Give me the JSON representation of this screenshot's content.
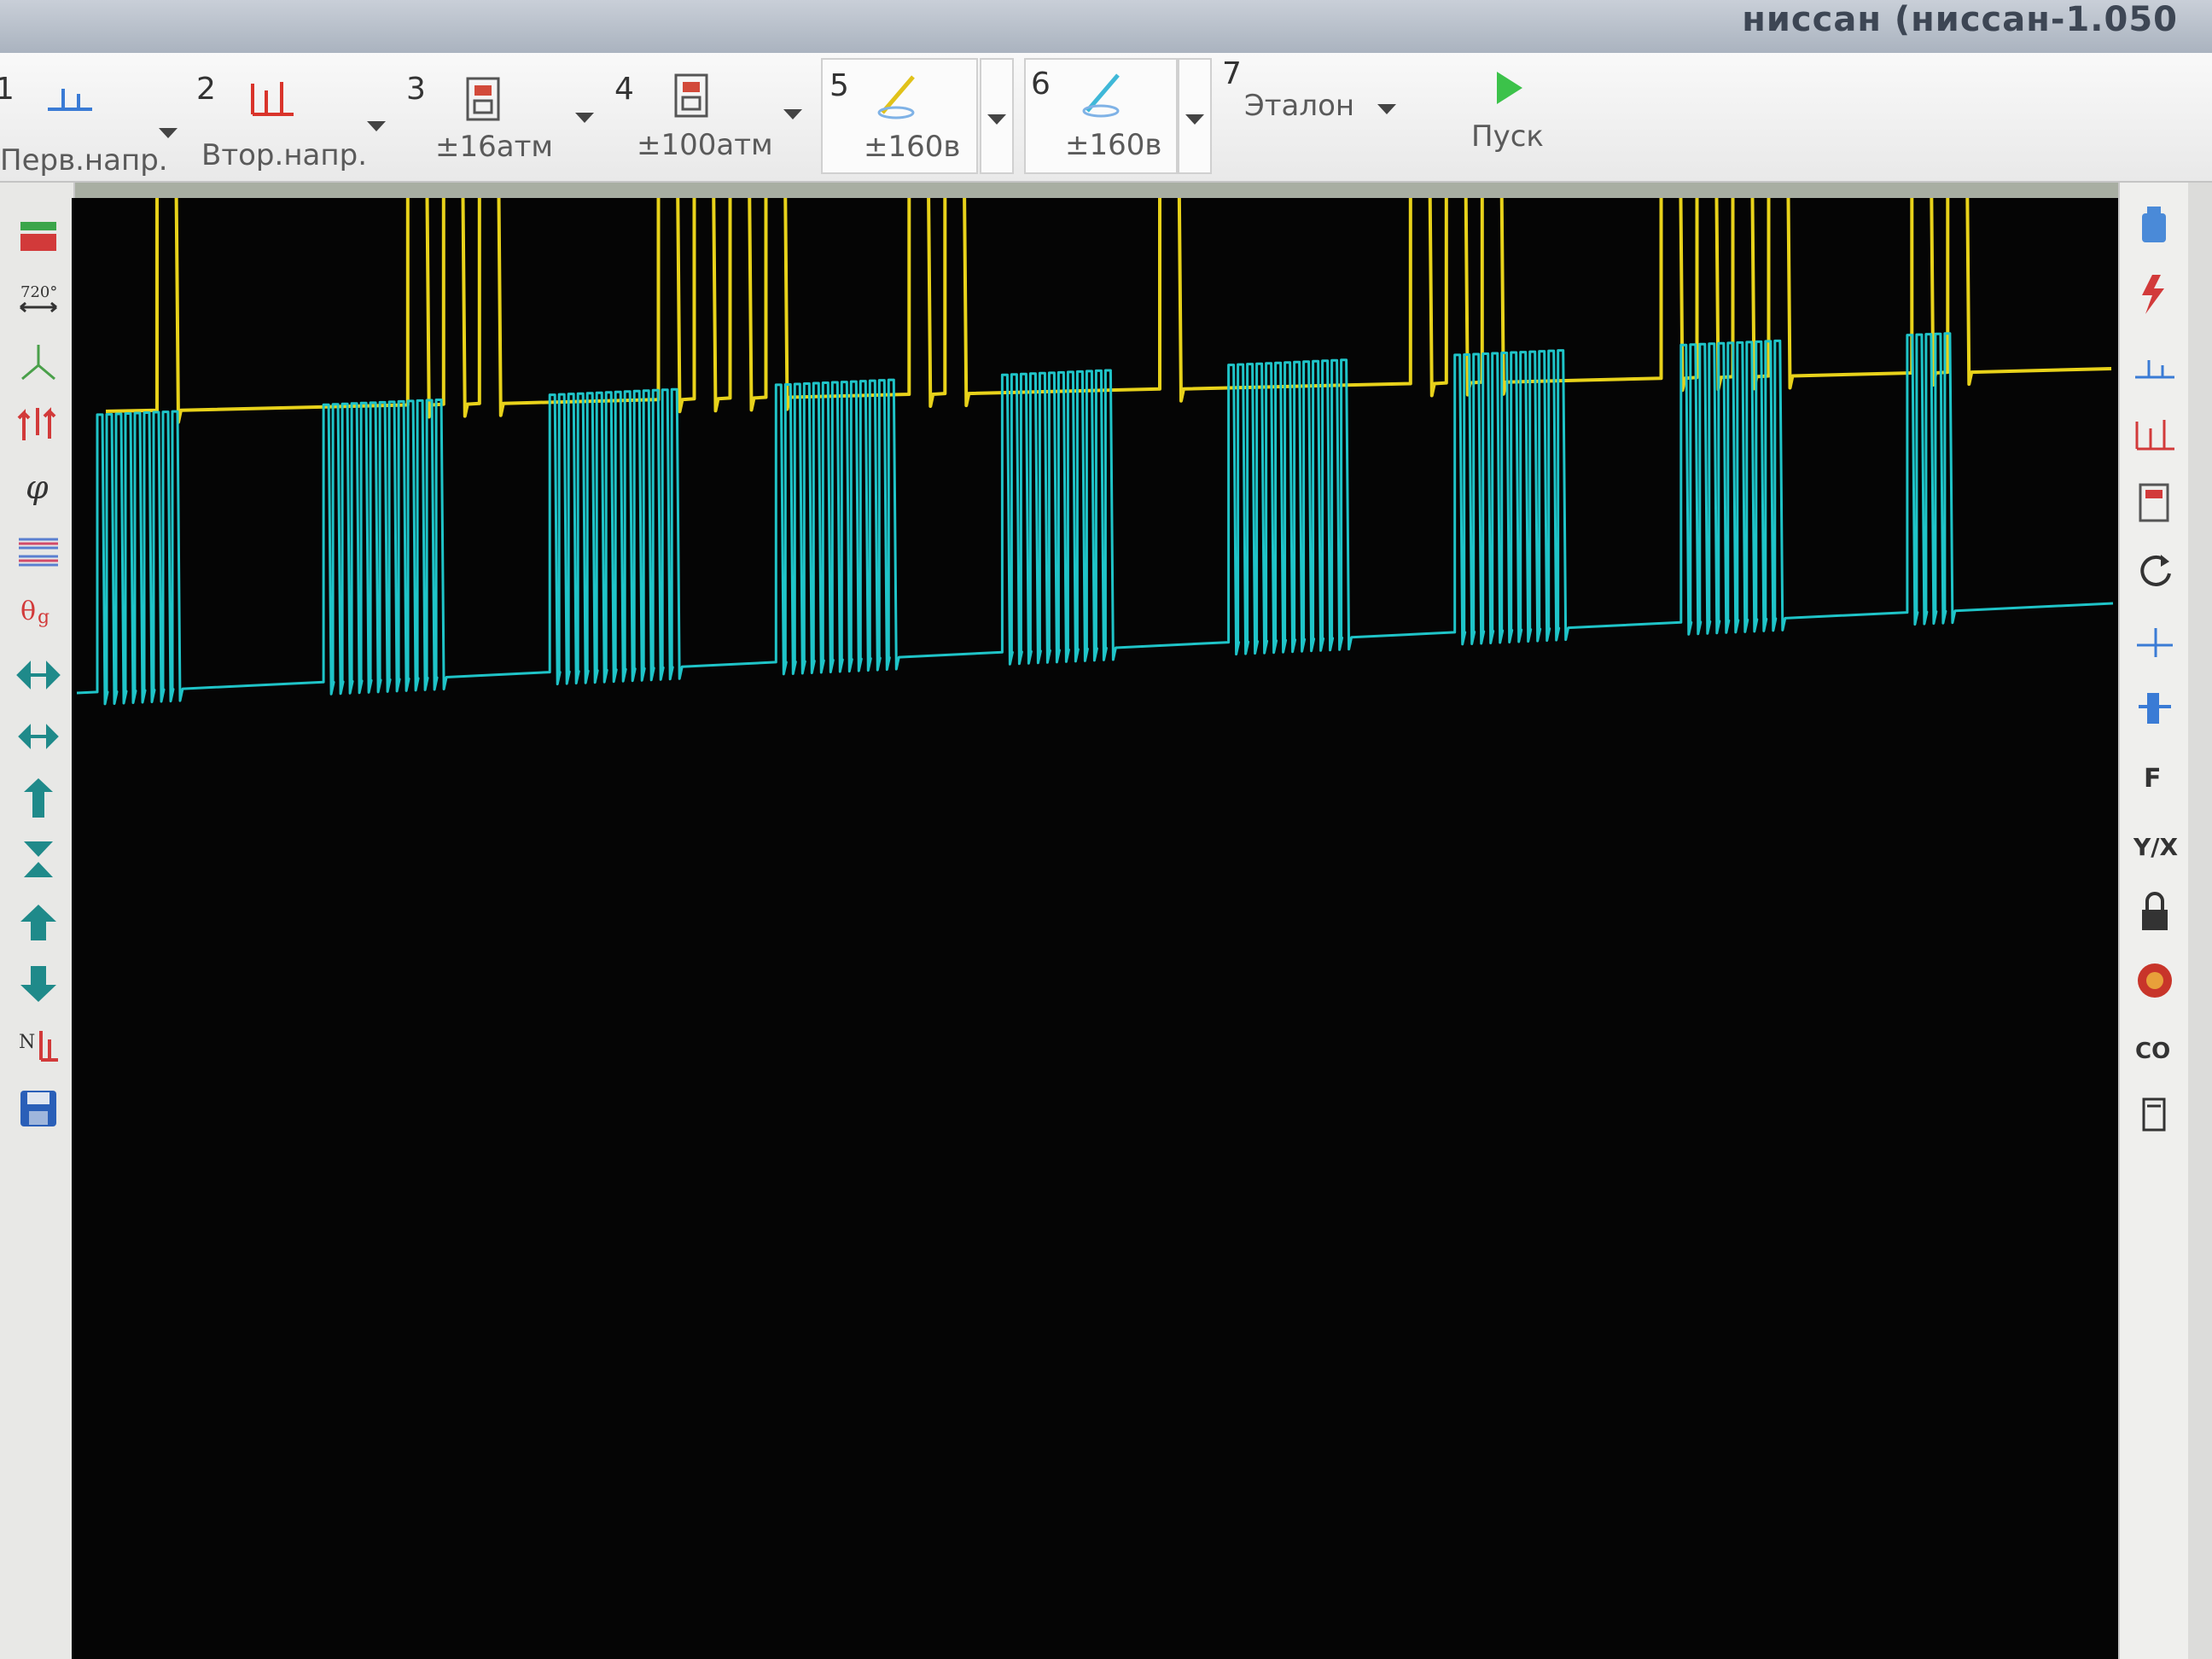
{
  "window": {
    "title": "ниссан (ниссан-1.050"
  },
  "toolbar": {
    "channels": [
      {
        "num": "1",
        "label": "Перв.напр.",
        "icon": "primary-voltage-icon"
      },
      {
        "num": "2",
        "label": "Втор.напр.",
        "icon": "secondary-voltage-icon"
      },
      {
        "num": "3",
        "label": "±16атм",
        "icon": "pressure-sensor-icon"
      },
      {
        "num": "4",
        "label": "±100атм",
        "icon": "pressure-sensor-icon"
      },
      {
        "num": "5",
        "label": "±160в",
        "icon": "probe-icon"
      },
      {
        "num": "6",
        "label": "±160в",
        "icon": "probe-icon"
      },
      {
        "num": "7",
        "label": "Эталон"
      }
    ],
    "start_label": "Пуск",
    "start_icon": "play-icon"
  },
  "left_tools": [
    "record-icon",
    "angle-720-icon",
    "sync-icon",
    "ignition-icon",
    "phi-icon",
    "layers-icon",
    "cylinder-icon",
    "move-horizontal-icon",
    "move-diagonal-icon",
    "move-up-icon",
    "stretch-vertical-icon",
    "shift-up-icon",
    "shift-down-icon",
    "marker-icon",
    "save-icon"
  ],
  "right_tools": [
    "bottle-icon",
    "spark-icon",
    "primary-voltage-icon",
    "secondary-voltage-icon",
    "pressure-sensor-icon",
    "refresh-icon",
    "cursor-tool-icon",
    "injector-icon",
    "F",
    "Y/X",
    "lock-icon",
    "target-icon",
    "CO",
    "panel-icon"
  ],
  "colors": {
    "channel_yellow": "#e8d21a",
    "channel_cyan": "#1fc4c8",
    "screen_bg": "#050505"
  },
  "chart_data": {
    "type": "line",
    "series": [
      {
        "color": "#e8d21a",
        "pulse_groups": [
          1,
          3,
          4,
          2,
          1,
          3,
          4,
          2
        ]
      },
      {
        "color": "#1fc4c8",
        "pulse_groups": [
          9,
          13,
          14,
          13,
          12,
          13,
          12,
          11,
          5
        ]
      }
    ]
  }
}
